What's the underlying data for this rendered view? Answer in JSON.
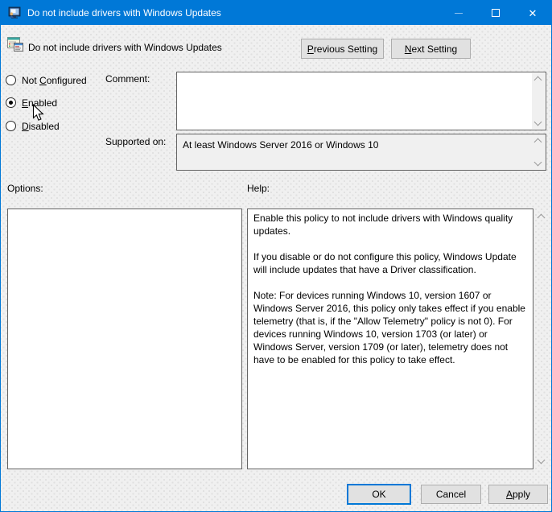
{
  "titlebar": {
    "title": "Do not include drivers with Windows Updates",
    "close_glyph": "✕"
  },
  "header": {
    "policy_title": "Do not include drivers with Windows Updates",
    "previous_button": {
      "accel": "P",
      "rest": "revious Setting"
    },
    "next_button": {
      "accel": "N",
      "rest": "ext Setting"
    }
  },
  "radios": {
    "not_configured": {
      "pre": "Not ",
      "accel": "C",
      "rest": "onfigured",
      "selected": false
    },
    "enabled": {
      "pre": "",
      "accel": "E",
      "rest": "nabled",
      "selected": true
    },
    "disabled": {
      "pre": "",
      "accel": "D",
      "rest": "isabled",
      "selected": false
    }
  },
  "comment": {
    "label": "Comment:",
    "value": ""
  },
  "supported_on": {
    "label": "Supported on:",
    "value": "At least Windows Server 2016 or Windows 10"
  },
  "options": {
    "label": "Options:"
  },
  "help": {
    "label": "Help:",
    "paragraphs": [
      "Enable this policy to not include drivers with Windows quality updates.",
      "If you disable or do not configure this policy, Windows Update will include updates that have a Driver classification.",
      "Note: For devices running Windows 10, version 1607 or Windows Server 2016, this policy only takes effect if you enable telemetry (that is, if the \"Allow Telemetry\" policy is not 0). For devices running Windows 10, version 1703 (or later) or Windows Server, version 1709 (or later), telemetry does not have to be enabled for this policy to take effect."
    ]
  },
  "buttons": {
    "ok": "OK",
    "cancel": "Cancel",
    "apply": {
      "accel": "A",
      "rest": "pply"
    }
  },
  "icons": {
    "app": "gpedit-monitor-icon",
    "policy": "policy-setting-icon",
    "minimize": "minimize-icon",
    "maximize": "maximize-icon",
    "close": "close-icon",
    "scroll_up": "chevron-up-icon",
    "scroll_down": "chevron-down-icon",
    "cursor": "mouse-cursor-icon"
  },
  "colors": {
    "titlebar": "#0078d7",
    "accent": "#0078d7",
    "window_bg": "#f0f0f0",
    "button_bg": "#e1e1e1",
    "button_border": "#adadad",
    "panel_border": "#646464"
  }
}
